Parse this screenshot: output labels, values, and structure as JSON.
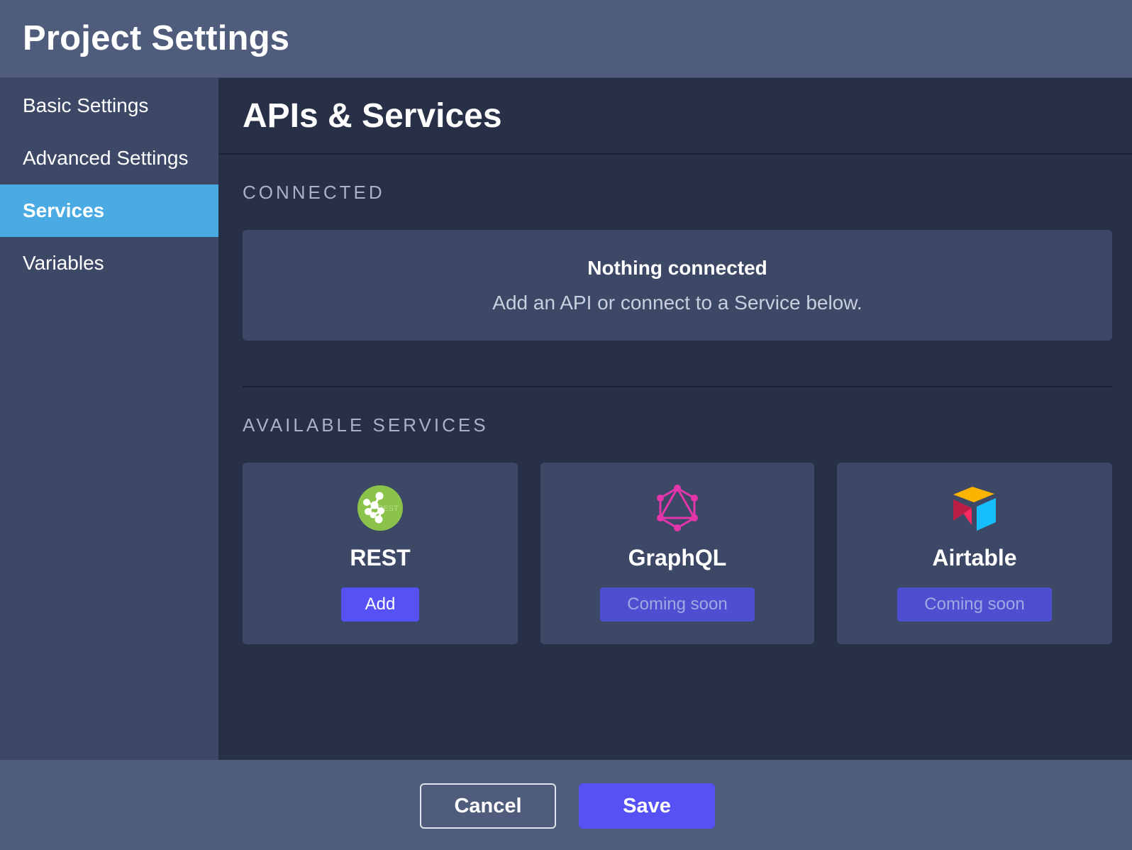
{
  "header": {
    "title": "Project Settings"
  },
  "sidebar": {
    "items": [
      {
        "label": "Basic Settings",
        "active": false
      },
      {
        "label": "Advanced Settings",
        "active": false
      },
      {
        "label": "Services",
        "active": true
      },
      {
        "label": "Variables",
        "active": false
      }
    ]
  },
  "main": {
    "title": "APIs & Services",
    "connected": {
      "label": "CONNECTED",
      "empty_title": "Nothing connected",
      "empty_subtitle": "Add an API or connect to a Service below."
    },
    "available": {
      "label": "AVAILABLE SERVICES",
      "services": [
        {
          "name": "REST",
          "icon": "rest-icon",
          "icon_text": "REST",
          "button_label": "Add",
          "enabled": true
        },
        {
          "name": "GraphQL",
          "icon": "graphql-icon",
          "button_label": "Coming soon",
          "enabled": false
        },
        {
          "name": "Airtable",
          "icon": "airtable-icon",
          "button_label": "Coming soon",
          "enabled": false
        }
      ]
    }
  },
  "footer": {
    "cancel_label": "Cancel",
    "save_label": "Save"
  },
  "colors": {
    "header_bg": "#505c7c",
    "sidebar_bg": "#3c4866",
    "main_bg": "#283048",
    "active_nav": "#4aabe3",
    "primary_button": "#5551f5",
    "disabled_button": "#4d4fd0",
    "rest_green": "#8bc34a",
    "graphql_pink": "#e535ab",
    "airtable_yellow": "#fcb400",
    "airtable_blue": "#18bfff",
    "airtable_red": "#f82b60"
  }
}
